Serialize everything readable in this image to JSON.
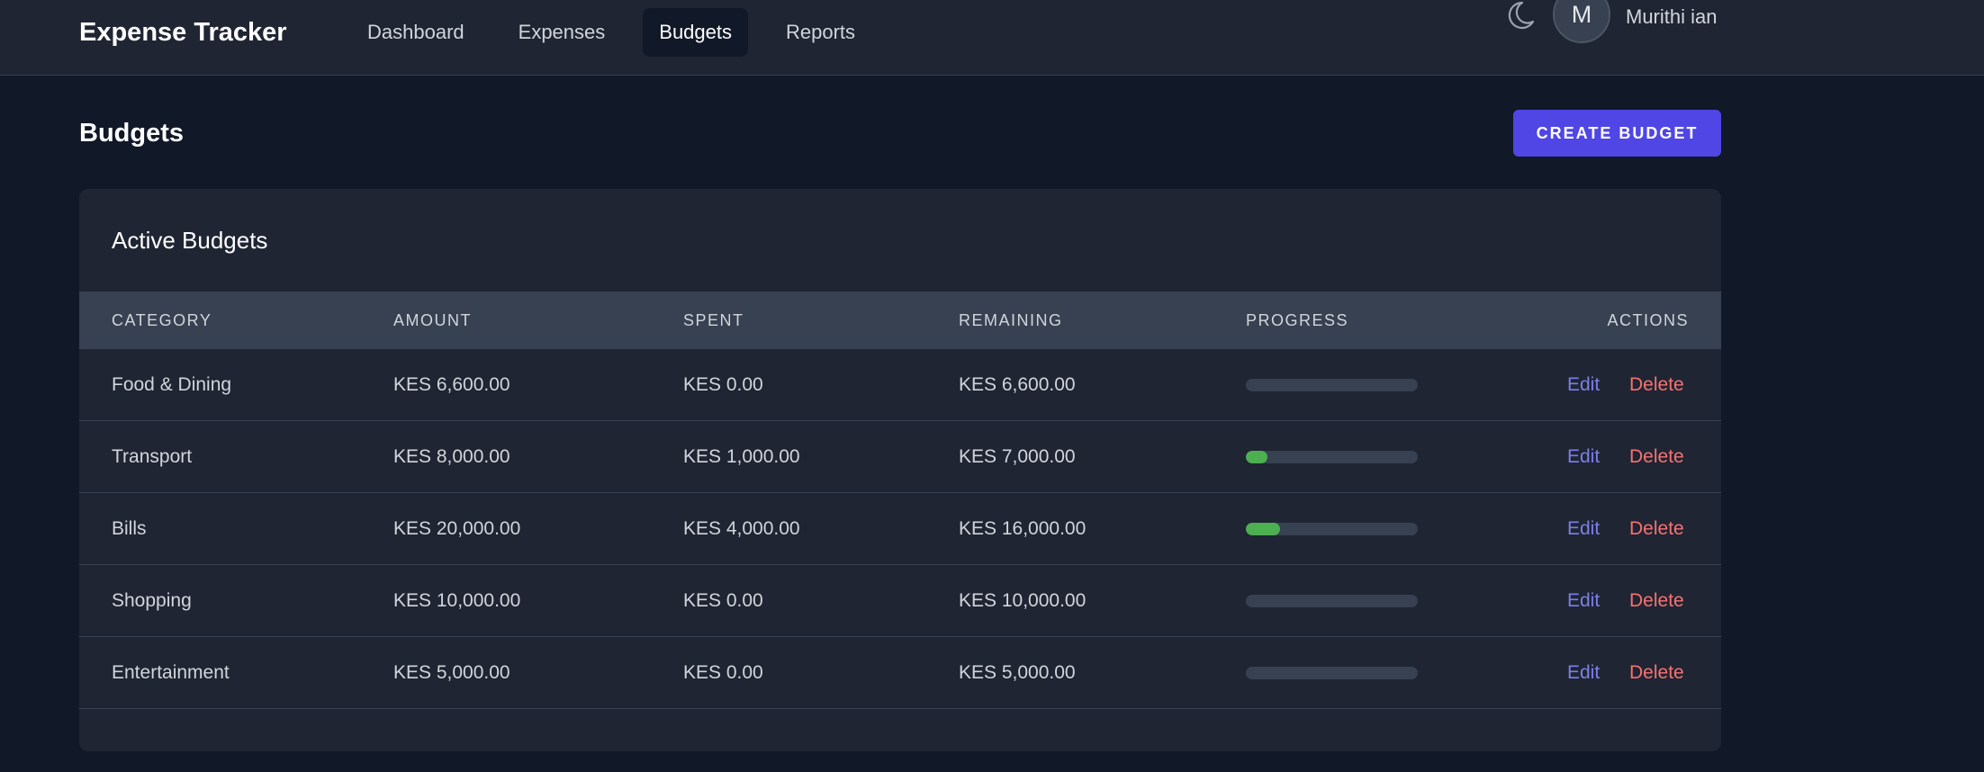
{
  "app": {
    "brand": "Expense Tracker"
  },
  "nav": {
    "items": [
      {
        "label": "Dashboard",
        "active": false
      },
      {
        "label": "Expenses",
        "active": false
      },
      {
        "label": "Budgets",
        "active": true
      },
      {
        "label": "Reports",
        "active": false
      }
    ]
  },
  "user": {
    "initial": "M",
    "name": "Murithi ian"
  },
  "icons": {
    "theme_toggle": "moon-icon"
  },
  "page": {
    "title": "Budgets",
    "create_button": "CREATE BUDGET"
  },
  "card": {
    "title": "Active Budgets"
  },
  "table": {
    "headers": [
      "CATEGORY",
      "AMOUNT",
      "SPENT",
      "REMAINING",
      "PROGRESS",
      "ACTIONS"
    ],
    "rows": [
      {
        "category": "Food & Dining",
        "amount": "KES 6,600.00",
        "spent": "KES 0.00",
        "remaining": "KES 6,600.00",
        "progress": 0,
        "edit": "Edit",
        "delete": "Delete"
      },
      {
        "category": "Transport",
        "amount": "KES 8,000.00",
        "spent": "KES 1,000.00",
        "remaining": "KES 7,000.00",
        "progress": 12.5,
        "edit": "Edit",
        "delete": "Delete"
      },
      {
        "category": "Bills",
        "amount": "KES 20,000.00",
        "spent": "KES 4,000.00",
        "remaining": "KES 16,000.00",
        "progress": 20,
        "edit": "Edit",
        "delete": "Delete"
      },
      {
        "category": "Shopping",
        "amount": "KES 10,000.00",
        "spent": "KES 0.00",
        "remaining": "KES 10,000.00",
        "progress": 0,
        "edit": "Edit",
        "delete": "Delete"
      },
      {
        "category": "Entertainment",
        "amount": "KES 5,000.00",
        "spent": "KES 0.00",
        "remaining": "KES 5,000.00",
        "progress": 0,
        "edit": "Edit",
        "delete": "Delete"
      }
    ]
  },
  "colors": {
    "background": "#111827",
    "surface": "#1f2533",
    "accent": "#4f46e5",
    "progress": "#4caf50",
    "edit": "#7c7fe8",
    "delete": "#f87171"
  }
}
